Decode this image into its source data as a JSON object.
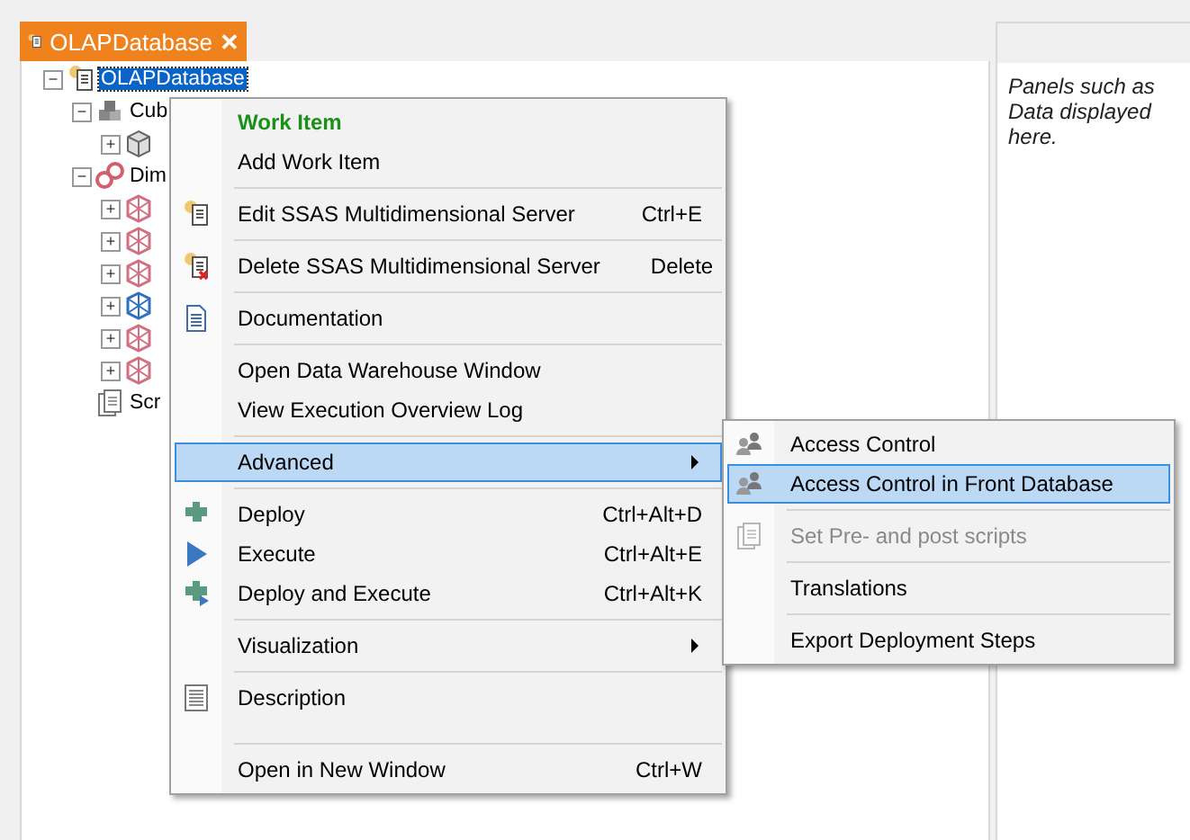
{
  "tab": {
    "title": "OLAPDatabase",
    "close": "✕"
  },
  "tree": [
    {
      "label": "OLAPDatabase",
      "toggle": "−",
      "selected": true,
      "children": [
        {
          "label": "Cub",
          "toggle": "−",
          "selected": false,
          "children": [
            {
              "toggle": "+"
            }
          ]
        },
        {
          "label": "Dim",
          "toggle": "−",
          "selected": false,
          "children": [
            {
              "toggle": "+"
            },
            {
              "toggle": "+"
            },
            {
              "toggle": "+"
            },
            {
              "toggle": "+"
            },
            {
              "toggle": "+"
            },
            {
              "toggle": "+"
            }
          ]
        },
        {
          "label": "Scr",
          "selected": false
        }
      ]
    }
  ],
  "side_panel": {
    "text": "Panels such as Data displayed here."
  },
  "context_menu": [
    {
      "kind": "header",
      "label": "Work Item"
    },
    {
      "kind": "item",
      "label": "Add Work Item",
      "selected": false
    },
    {
      "kind": "separator"
    },
    {
      "kind": "item",
      "label": "Edit SSAS Multidimensional Server",
      "shortcut": "Ctrl+E",
      "selected": false
    },
    {
      "kind": "separator"
    },
    {
      "kind": "item",
      "label": "Delete SSAS Multidimensional Server",
      "shortcut": "Delete",
      "selected": false
    },
    {
      "kind": "separator"
    },
    {
      "kind": "item",
      "label": "Documentation",
      "selected": false
    },
    {
      "kind": "separator"
    },
    {
      "kind": "item",
      "label": "Open Data Warehouse Window",
      "selected": false
    },
    {
      "kind": "item",
      "label": "View Execution Overview Log",
      "selected": false
    },
    {
      "kind": "separator"
    },
    {
      "kind": "item",
      "label": "Advanced",
      "submenu": true,
      "selected": true
    },
    {
      "kind": "separator"
    },
    {
      "kind": "item",
      "label": "Deploy",
      "shortcut": "Ctrl+Alt+D",
      "selected": false
    },
    {
      "kind": "item",
      "label": "Execute",
      "shortcut": "Ctrl+Alt+E",
      "selected": false
    },
    {
      "kind": "item",
      "label": "Deploy and Execute",
      "shortcut": "Ctrl+Alt+K",
      "selected": false
    },
    {
      "kind": "separator"
    },
    {
      "kind": "item",
      "label": "Visualization",
      "submenu": true,
      "selected": false
    },
    {
      "kind": "separator"
    },
    {
      "kind": "item",
      "label": "Description",
      "selected": false
    },
    {
      "kind": "blank"
    },
    {
      "kind": "separator"
    },
    {
      "kind": "item",
      "label": "Open in New Window",
      "shortcut": "Ctrl+W",
      "selected": false
    }
  ],
  "submenu": [
    {
      "kind": "item",
      "label": "Access Control",
      "selected": false
    },
    {
      "kind": "item",
      "label": "Access Control in Front Database",
      "selected": true
    },
    {
      "kind": "separator"
    },
    {
      "kind": "item",
      "label": "Set Pre- and post scripts",
      "disabled": true,
      "selected": false
    },
    {
      "kind": "separator"
    },
    {
      "kind": "item",
      "label": "Translations",
      "selected": false
    },
    {
      "kind": "separator"
    },
    {
      "kind": "item",
      "label": "Export Deployment Steps",
      "selected": false
    }
  ]
}
